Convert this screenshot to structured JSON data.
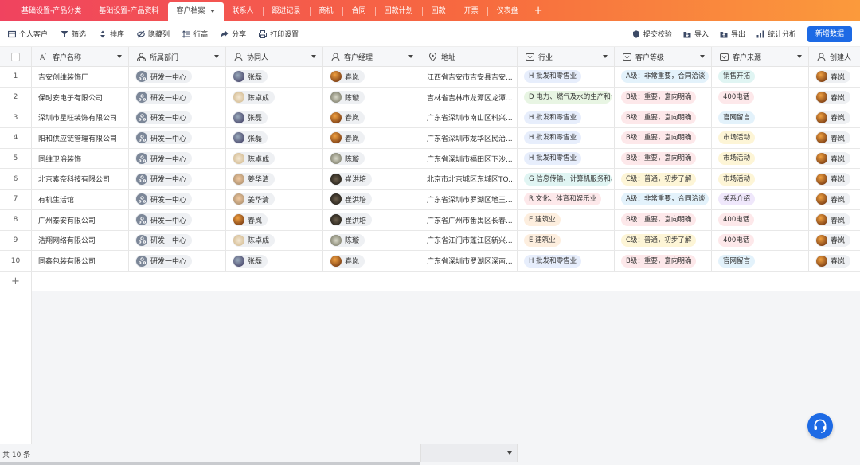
{
  "tabs": [
    {
      "label": "基础设置-产品分类"
    },
    {
      "label": "基础设置-产品资料"
    },
    {
      "label": "客户档案"
    },
    {
      "label": "联系人"
    },
    {
      "label": "跟进记录"
    },
    {
      "label": "商机"
    },
    {
      "label": "合同"
    },
    {
      "label": "回款计划"
    },
    {
      "label": "回款"
    },
    {
      "label": "开票"
    },
    {
      "label": "仪表盘"
    }
  ],
  "tab_add": "+",
  "toolbar": {
    "personal": "个人客户",
    "filter": "筛选",
    "sort": "排序",
    "hide": "隐藏列",
    "row_height": "行高",
    "share": "分享",
    "print": "打印设置",
    "submit_check": "提交校验",
    "import": "导入",
    "export": "导出",
    "stats": "统计分析",
    "new_data": "新增数据"
  },
  "columns": {
    "name": "客户名称",
    "dept": "所属部门",
    "collab": "协同人",
    "manager": "客户经理",
    "address": "地址",
    "industry": "行业",
    "level": "客户等级",
    "source": "客户来源",
    "creator": "创建人"
  },
  "rows": [
    {
      "no": "1",
      "name": "吉安创维装饰厂",
      "dept": "研发一中心",
      "collab": "张磊",
      "manager": "春岚",
      "address": "江西省吉安市吉安县吉安...",
      "industry": "H 批发和零售业",
      "level": "A级：非常重要，合同洽谈",
      "source": "销售开拓",
      "creator": "春岚"
    },
    {
      "no": "2",
      "name": "保时安电子有限公司",
      "dept": "研发一中心",
      "collab": "陈卓成",
      "manager": "陈璇",
      "address": "吉林省吉林市龙潭区龙潭...",
      "industry": "D 电力、燃气及水的生产和供应",
      "level": "B级：重要，意向明确",
      "source": "400电话",
      "creator": "春岚"
    },
    {
      "no": "3",
      "name": "深圳市星旺装饰有限公司",
      "dept": "研发一中心",
      "collab": "张磊",
      "manager": "春岚",
      "address": "广东省深圳市南山区科兴...",
      "industry": "H 批发和零售业",
      "level": "B级：重要，意向明确",
      "source": "官网留言",
      "creator": "春岚"
    },
    {
      "no": "4",
      "name": "阳和供应链管理有限公司",
      "dept": "研发一中心",
      "collab": "张磊",
      "manager": "春岚",
      "address": "广东省深圳市龙华区民治...",
      "industry": "H 批发和零售业",
      "level": "B级：重要，意向明确",
      "source": "市场活动",
      "creator": "春岚"
    },
    {
      "no": "5",
      "name": "同维卫浴装饰",
      "dept": "研发一中心",
      "collab": "陈卓成",
      "manager": "陈璇",
      "address": "广东省深圳市福田区下沙...",
      "industry": "H 批发和零售业",
      "level": "B级：重要，意向明确",
      "source": "市场活动",
      "creator": "春岚"
    },
    {
      "no": "6",
      "name": "北京素奈科技有限公司",
      "dept": "研发一中心",
      "collab": "姜华清",
      "manager": "崔洪培",
      "address": "北京市北京城区东城区TO...",
      "industry": "G 信息传输、计算机服务和软件业",
      "level": "C级：普通，初步了解",
      "source": "市场活动",
      "creator": "春岚"
    },
    {
      "no": "7",
      "name": "有机生活馆",
      "dept": "研发一中心",
      "collab": "姜华清",
      "manager": "崔洪培",
      "address": "广东省深圳市罗湖区地王...",
      "industry": "R 文化、体育和娱乐业",
      "level": "A级：非常重要，合同洽谈",
      "source": "关系介绍",
      "creator": "春岚"
    },
    {
      "no": "8",
      "name": "广州泰安有限公司",
      "dept": "研发一中心",
      "collab": "春岚",
      "manager": "崔洪培",
      "address": "广东省广州市番禺区长春...",
      "industry": "E 建筑业",
      "level": "B级：重要，意向明确",
      "source": "400电话",
      "creator": "春岚"
    },
    {
      "no": "9",
      "name": "浩翔网络有限公司",
      "dept": "研发一中心",
      "collab": "陈卓成",
      "manager": "陈璇",
      "address": "广东省江门市蓬江区新兴...",
      "industry": "E 建筑业",
      "level": "C级：普通，初步了解",
      "source": "400电话",
      "creator": "春岚"
    },
    {
      "no": "10",
      "name": "同鑫包装有限公司",
      "dept": "研发一中心",
      "collab": "张磊",
      "manager": "春岚",
      "address": "广东省深圳市罗湖区深南...",
      "industry": "H 批发和零售业",
      "level": "B级：重要，意向明确",
      "source": "官网留言",
      "creator": "春岚"
    }
  ],
  "add_row": "+",
  "footer": {
    "count": "共 10 条"
  },
  "colors": {
    "accent": "#1d6ae5",
    "tab_gradient_start": "#f0435f",
    "tab_gradient_end": "#fb9a3c"
  }
}
